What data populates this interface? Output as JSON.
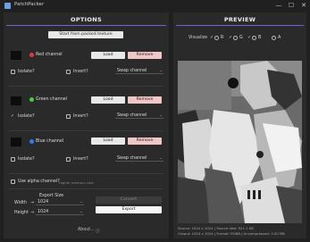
{
  "window": {
    "title": "PatchPacker",
    "minimize_glyph": "—",
    "maximize_glyph": "☐",
    "close_glyph": "✕"
  },
  "options": {
    "title": "OPTIONS",
    "start_from_packed_label": "Start from packed texture",
    "channels": [
      {
        "name": "Red channel",
        "color": "#e53935",
        "load": "Load",
        "remove": "Remove",
        "isolate": "Isolate?",
        "invert": "Invert?",
        "swap": "Swap channel",
        "isolate_checked": false
      },
      {
        "name": "Green channel",
        "color": "#43d13a",
        "load": "Load",
        "remove": "Remove",
        "isolate": "Isolate?",
        "invert": "Invert?",
        "swap": "Swap channel",
        "isolate_checked": true
      },
      {
        "name": "Blue channel",
        "color": "#2f7cf6",
        "load": "Load",
        "remove": "Remove",
        "isolate": "Isolate?",
        "invert": "Invert?",
        "swap": "Swap channel",
        "isolate_checked": false
      }
    ],
    "alpha_label": "Use alpha channel?",
    "alpha_note": "Higher memory cost",
    "export_size_label": "Export Size",
    "width_label": "Width",
    "width_value": "1024",
    "height_label": "Height",
    "height_value": "1024",
    "arrow_glyph": "→",
    "convert_label": "Convert",
    "export_label": "Export",
    "about_label": "About...",
    "about_icon": "ⓘ"
  },
  "preview": {
    "title": "PREVIEW",
    "visualize_label": "Visualize",
    "radios": [
      {
        "label": "R",
        "checked": true
      },
      {
        "label": "G",
        "checked": true
      },
      {
        "label": "B",
        "checked": true
      },
      {
        "label": "A",
        "checked": false
      }
    ],
    "info_line1": "Source: 1024 x 1024 | Source disk: 921.1 KB",
    "info_line2": "Output: 1024 x 1024 | Format: RGB8 | Uncompressed: 3.00 MB"
  }
}
